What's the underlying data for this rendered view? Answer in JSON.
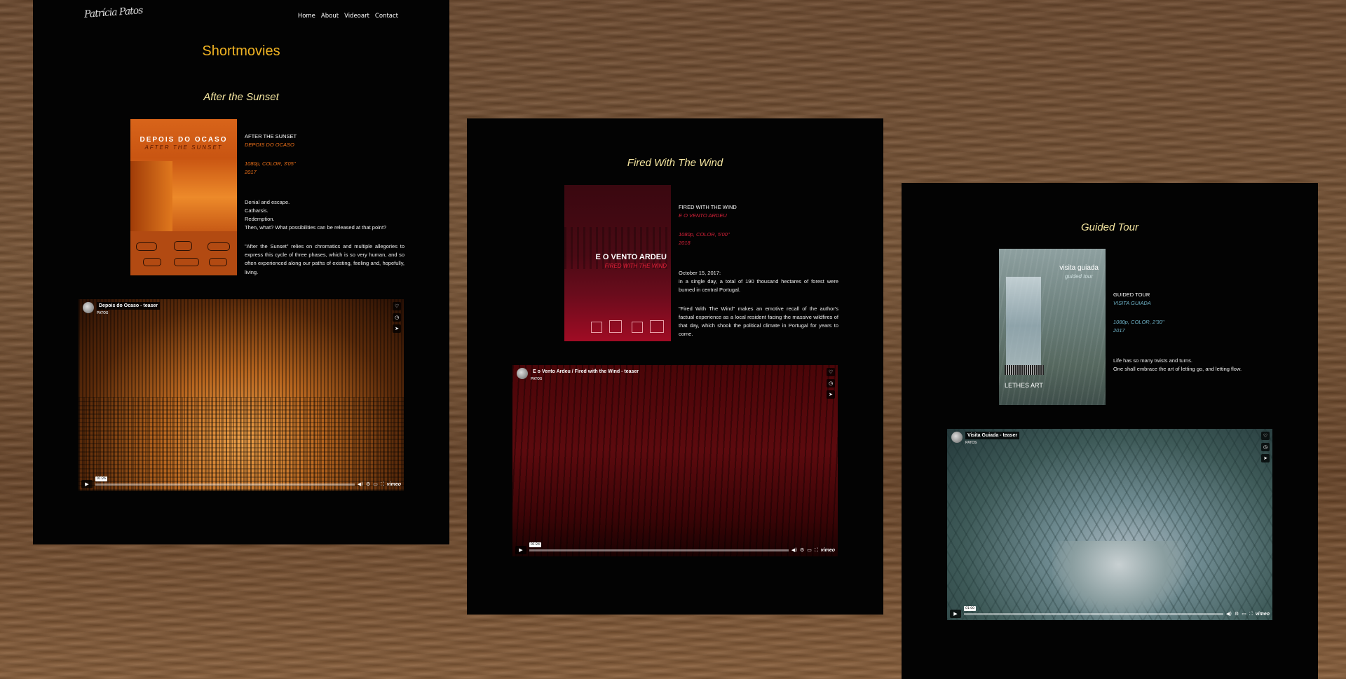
{
  "site": {
    "logo_text": "Patrícia Patos",
    "nav": [
      "Home",
      "About",
      "Videoart",
      "Contact"
    ],
    "page_title": "Shortmovies"
  },
  "films": [
    {
      "heading": "After the Sunset",
      "poster": {
        "title": "DEPOIS DO OCASO",
        "subtitle": "AFTER THE SUNSET",
        "colors": {
          "top": "#d8641a",
          "mid": "#ed8a2a",
          "bottom": "#b9480e",
          "text": "#ffffff",
          "subtitle": "#5a1800"
        }
      },
      "title_en": "AFTER THE SUNSET",
      "title_orig": "DEPOIS DO OCASO",
      "specs": "1080p, COLOR, 3'05''",
      "year": "2017",
      "accent": "#f2731a",
      "lines": [
        "Denial and escape.",
        "Catharsis.",
        "Redemption.",
        "Then, what? What possibilities can be released at that point?"
      ],
      "paragraph": "\"After the Sunset\" relies on chromatics and multiple allegories to express this cycle of three phases, which is so very human, and so often experienced along our paths of existing, feeling and, hopefully, living.",
      "video": {
        "title": "Depois do Ocaso - teaser",
        "by": "PATOS",
        "time": "01:26",
        "brand": "vimeo"
      }
    },
    {
      "heading": "Fired With The Wind",
      "poster": {
        "title": "E O VENTO ARDEU",
        "subtitle": "FIRED WITH THE WIND",
        "colors": {
          "top": "#3a0810",
          "mid": "#5a0a18",
          "bottom": "#a00c24",
          "text": "#ffffff",
          "subtitle": "#e8213a"
        }
      },
      "title_en": "FIRED WITH THE WIND",
      "title_orig": "E O VENTO ARDEU",
      "specs": "1080p, COLOR, 5'00''",
      "year": "2018",
      "accent": "#d8223a",
      "lines": [
        "October 15, 2017:"
      ],
      "paragraph": "in a single day, a total of 190 thousand hectares of forest were burned in central Portugal.",
      "paragraph2": "\"Fired With The Wind\" makes an emotive recall of the author's factual experience as a local resident facing the massive wildfires of that day, which shook the political climate in Portugal for years to come.",
      "video": {
        "title": "E o Vento Ardeu / Fired with the Wind - teaser",
        "by": "PATOS",
        "time": "01:24",
        "brand": "vimeo"
      }
    },
    {
      "heading": "Guided Tour",
      "poster": {
        "title": "visita guiada",
        "subtitle": "guided tour",
        "footer": "LETHES ART",
        "colors": {
          "top": "#8ea0a0",
          "mid": "#6a7e7a",
          "bottom": "#3e4e4a",
          "text": "#ffffff",
          "subtitle": "#cfe0e0"
        }
      },
      "title_en": "GUIDED TOUR",
      "title_orig": "VISITA GUIADA",
      "specs": "1080p, COLOR, 2'30''",
      "year": "2017",
      "accent": "#6fb3c8",
      "lines": [
        "Life has so many twists and turns.",
        "One shall embrace the art of letting go, and letting flow."
      ],
      "video": {
        "title": "Visita Guiada - teaser",
        "by": "PATOS",
        "time": "01:00",
        "brand": "vimeo"
      }
    }
  ]
}
